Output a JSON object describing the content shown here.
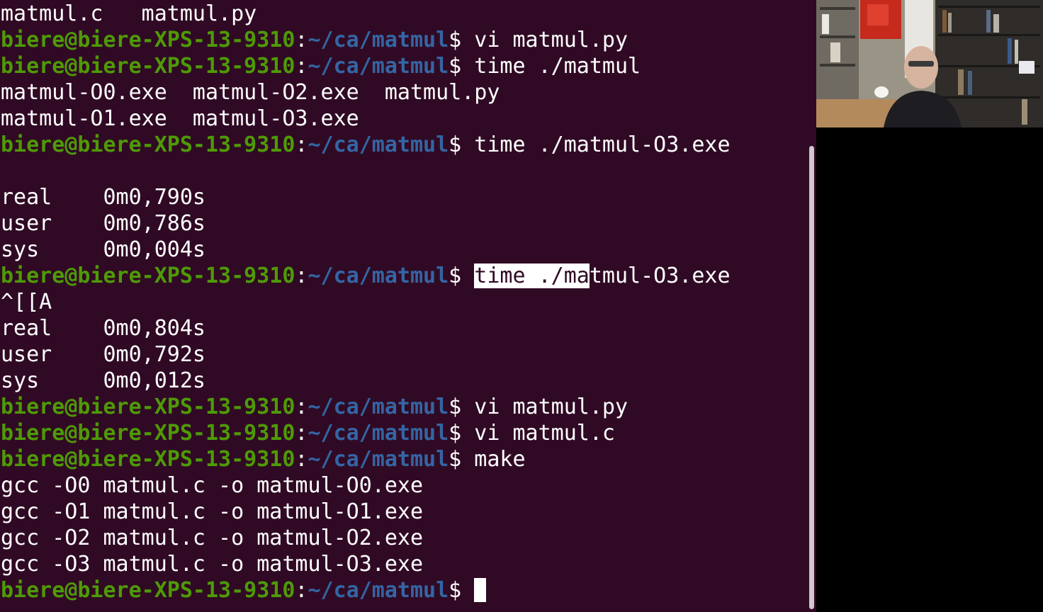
{
  "terminal": {
    "prompt": {
      "user": "biere@biere-XPS-13-9310",
      "separator": ":",
      "path": "~/ca/matmul",
      "symbol": "$"
    },
    "lines": [
      {
        "kind": "output",
        "text": "matmul.c   matmul.py"
      },
      {
        "kind": "prompt",
        "cmd": "vi matmul.py"
      },
      {
        "kind": "prompt",
        "cmd": "time ./matmul"
      },
      {
        "kind": "output",
        "text": "matmul-O0.exe  matmul-O2.exe  matmul.py"
      },
      {
        "kind": "output",
        "text": "matmul-O1.exe  matmul-O3.exe"
      },
      {
        "kind": "prompt",
        "cmd": "time ./matmul-O3.exe"
      },
      {
        "kind": "output",
        "text": ""
      },
      {
        "kind": "output",
        "text": "real    0m0,790s"
      },
      {
        "kind": "output",
        "text": "user    0m0,786s"
      },
      {
        "kind": "output",
        "text": "sys     0m0,004s"
      },
      {
        "kind": "prompt",
        "cmd_selected": "time ./ma",
        "cmd": "tmul-O3.exe"
      },
      {
        "kind": "output",
        "text": "^[[A"
      },
      {
        "kind": "output",
        "text": "real    0m0,804s"
      },
      {
        "kind": "output",
        "text": "user    0m0,792s"
      },
      {
        "kind": "output",
        "text": "sys     0m0,012s"
      },
      {
        "kind": "prompt",
        "cmd": "vi matmul.py"
      },
      {
        "kind": "prompt",
        "cmd": "vi matmul.c"
      },
      {
        "kind": "prompt",
        "cmd": "make"
      },
      {
        "kind": "output",
        "text": "gcc -O0 matmul.c -o matmul-O0.exe"
      },
      {
        "kind": "output",
        "text": "gcc -O1 matmul.c -o matmul-O1.exe"
      },
      {
        "kind": "output",
        "text": "gcc -O2 matmul.c -o matmul-O2.exe"
      },
      {
        "kind": "output",
        "text": "gcc -O3 matmul.c -o matmul-O3.exe"
      },
      {
        "kind": "prompt",
        "cmd": "",
        "cursor": true
      }
    ]
  },
  "colors": {
    "background": "#300a24",
    "user_host": "#4e9a06",
    "path": "#3465a4",
    "text": "#ffffff",
    "selection": "#ffffff"
  },
  "webcam": {
    "description_icon": "webcam-video-icon"
  }
}
